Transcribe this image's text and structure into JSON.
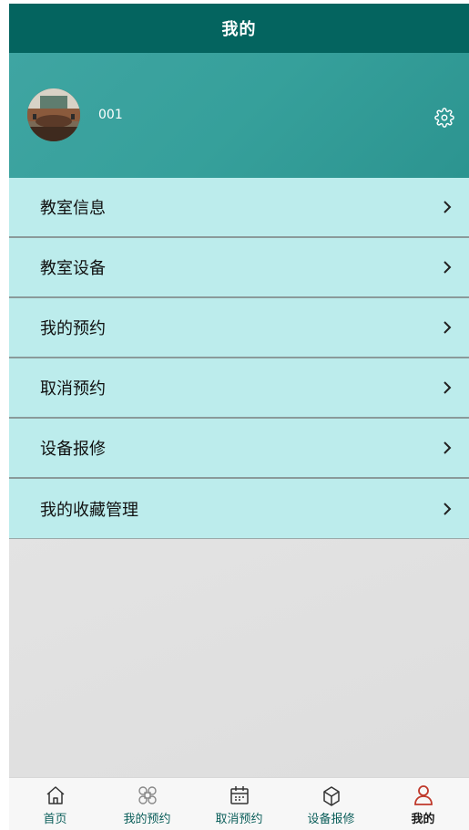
{
  "header": {
    "title": "我的"
  },
  "profile": {
    "username": "001"
  },
  "menu": {
    "items": [
      {
        "label": "教室信息"
      },
      {
        "label": "教室设备"
      },
      {
        "label": "我的预约"
      },
      {
        "label": "取消预约"
      },
      {
        "label": "设备报修"
      },
      {
        "label": "我的收藏管理"
      }
    ]
  },
  "tabbar": {
    "tabs": [
      {
        "label": "首页",
        "icon": "home-icon"
      },
      {
        "label": "我的预约",
        "icon": "command-icon"
      },
      {
        "label": "取消预约",
        "icon": "calendar-icon"
      },
      {
        "label": "设备报修",
        "icon": "box-icon"
      },
      {
        "label": "我的",
        "icon": "user-icon",
        "active": true
      }
    ]
  },
  "colors": {
    "header": "#04645f",
    "profile": "#36a09b",
    "menu_item": "#bcecec",
    "tab_active": "#c0392b"
  }
}
